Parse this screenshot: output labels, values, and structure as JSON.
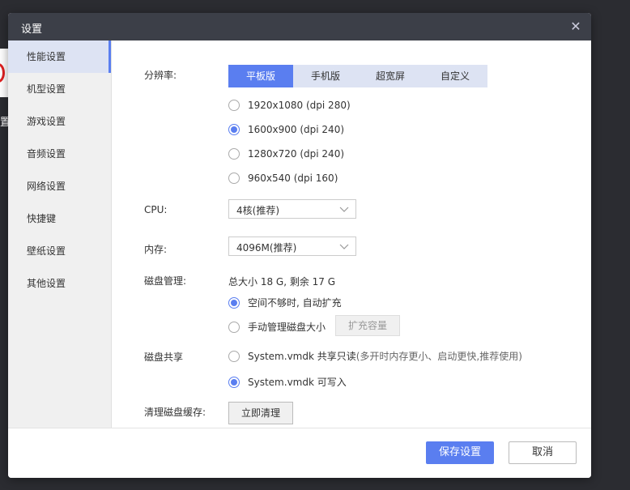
{
  "background": {
    "fragment_text": "置"
  },
  "dialog": {
    "title": "设置",
    "close_icon": "✕"
  },
  "sidebar": {
    "items": [
      {
        "label": "性能设置"
      },
      {
        "label": "机型设置"
      },
      {
        "label": "游戏设置"
      },
      {
        "label": "音频设置"
      },
      {
        "label": "网络设置"
      },
      {
        "label": "快捷键"
      },
      {
        "label": "壁纸设置"
      },
      {
        "label": "其他设置"
      }
    ]
  },
  "resolution": {
    "label": "分辨率:",
    "tabs": [
      "平板版",
      "手机版",
      "超宽屏",
      "自定义"
    ],
    "options": [
      "1920x1080 (dpi 280)",
      "1600x900 (dpi 240)",
      "1280x720 (dpi 240)",
      "960x540 (dpi 160)"
    ]
  },
  "cpu": {
    "label": "CPU:",
    "value": "4核(推荐)"
  },
  "memory": {
    "label": "内存:",
    "value": "4096M(推荐)"
  },
  "disk": {
    "label": "磁盘管理:",
    "summary": "总大小 18 G, 剩余 17 G",
    "auto_label": "空间不够时, 自动扩充",
    "manual_label": "手动管理磁盘大小",
    "expand_button": "扩充容量"
  },
  "disk_share": {
    "label": "磁盘共享",
    "readonly_label": "System.vmdk 共享只读",
    "readonly_note": "(多开时内存更小、启动更快,推荐使用)",
    "writable_label": "System.vmdk 可写入"
  },
  "cache": {
    "label": "清理磁盘缓存:",
    "button": "立即清理"
  },
  "footer": {
    "save": "保存设置",
    "cancel": "取消"
  },
  "colors": {
    "accent": "#5a7ef0",
    "titlebar": "#3c3f48",
    "sidebar": "#f0f0f0"
  }
}
